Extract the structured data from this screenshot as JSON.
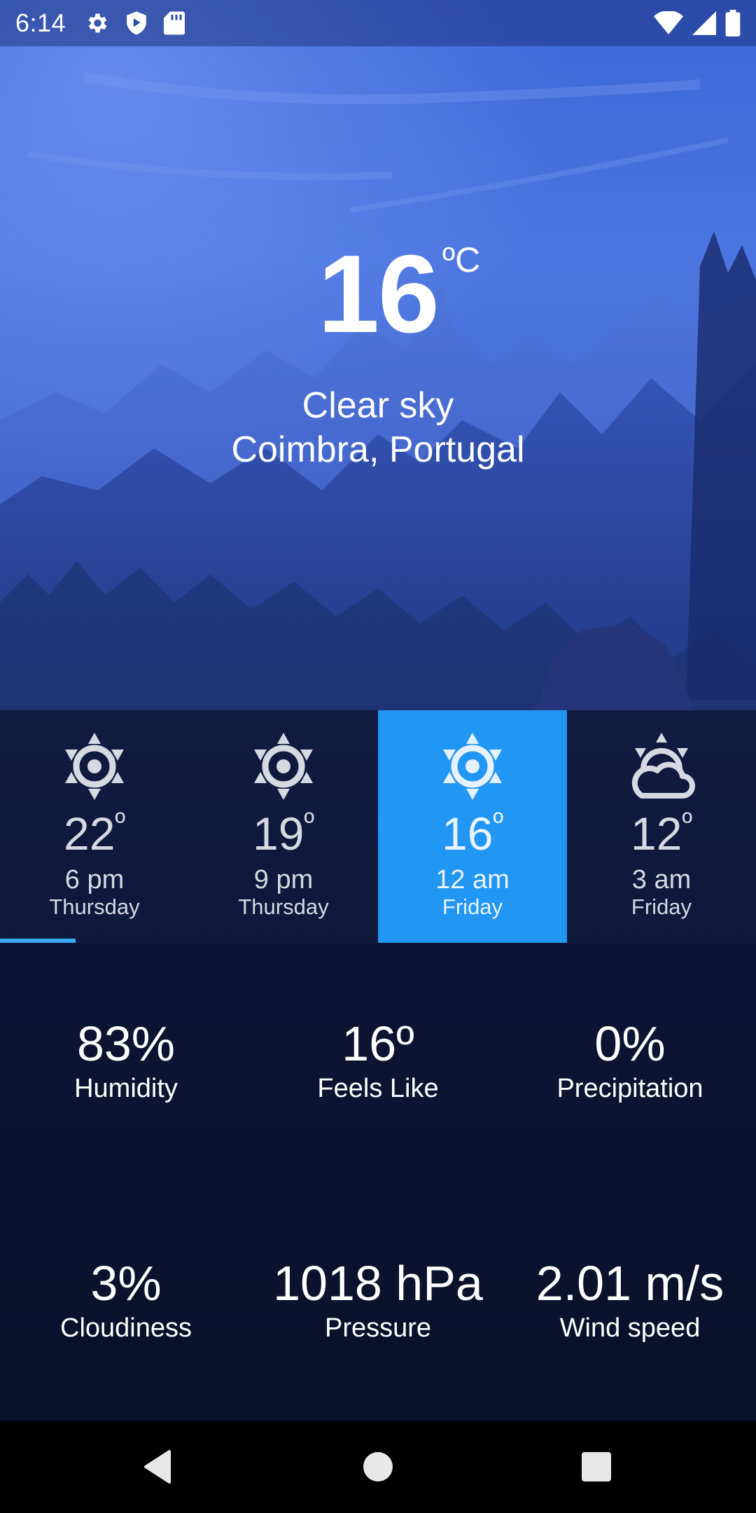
{
  "status_bar": {
    "time": "6:14",
    "left_icons": [
      "gear-icon",
      "shield-icon",
      "sd-card-icon"
    ],
    "right_icons": [
      "wifi-icon",
      "signal-icon",
      "battery-icon"
    ]
  },
  "current": {
    "temperature": "16",
    "unit": "ºC",
    "condition": "Clear sky",
    "location": "Coimbra, Portugal"
  },
  "forecast": [
    {
      "icon": "sun-icon",
      "temp": "22",
      "deg": "º",
      "time": "6 pm",
      "day": "Thursday"
    },
    {
      "icon": "sun-icon",
      "temp": "19",
      "deg": "º",
      "time": "9 pm",
      "day": "Thursday"
    },
    {
      "icon": "sun-icon",
      "temp": "16",
      "deg": "º",
      "time": "12 am",
      "day": "Friday"
    },
    {
      "icon": "sun-cloud-icon",
      "temp": "12",
      "deg": "º",
      "time": "3 am",
      "day": "Friday"
    }
  ],
  "forecast_selected_index": 2,
  "details": [
    {
      "value": "83%",
      "label": "Humidity"
    },
    {
      "value": "16º",
      "label": "Feels Like"
    },
    {
      "value": "0%",
      "label": "Precipitation"
    },
    {
      "value": "3%",
      "label": "Cloudiness"
    },
    {
      "value": "1018 hPa",
      "label": "Pressure"
    },
    {
      "value": "2.01 m/s",
      "label": "Wind speed"
    }
  ],
  "colors": {
    "accent": "#2196f3",
    "indicator": "#38a8f4",
    "sky": "#4a72de",
    "panel": "#0a122c"
  },
  "nav_bar": {
    "buttons": [
      "back-icon",
      "home-icon",
      "recents-icon"
    ]
  }
}
